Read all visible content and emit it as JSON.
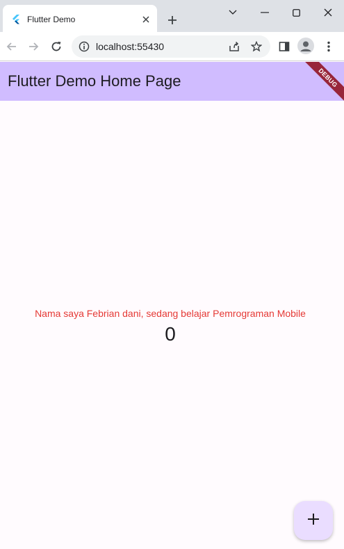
{
  "browser": {
    "tab": {
      "title": "Flutter Demo",
      "favicon": "flutter-logo-icon"
    },
    "new_tab": "plus-icon",
    "window_controls": [
      "minimize-icon",
      "maximize-icon",
      "close-icon"
    ],
    "toolbar": {
      "back": "arrow-left-icon",
      "forward": "arrow-right-icon",
      "reload": "reload-icon",
      "url": "localhost:55430",
      "site_info": "info-icon",
      "share": "share-icon",
      "bookmark": "star-icon",
      "side_panel": "side-panel-icon",
      "profile": "avatar",
      "menu": "kebab-menu-icon"
    }
  },
  "app": {
    "title": "Flutter Demo Home Page",
    "debug_banner": "DEBUG",
    "message": "Nama saya Febrian dani, sedang belajar Pemrograman Mobile",
    "counter": "0",
    "fab_icon": "plus-icon"
  },
  "colors": {
    "appbar": "#d0bcff",
    "background": "#fffbfe",
    "message_text": "#e53935",
    "fab": "#eaddff",
    "debug_banner": "#98263a"
  }
}
